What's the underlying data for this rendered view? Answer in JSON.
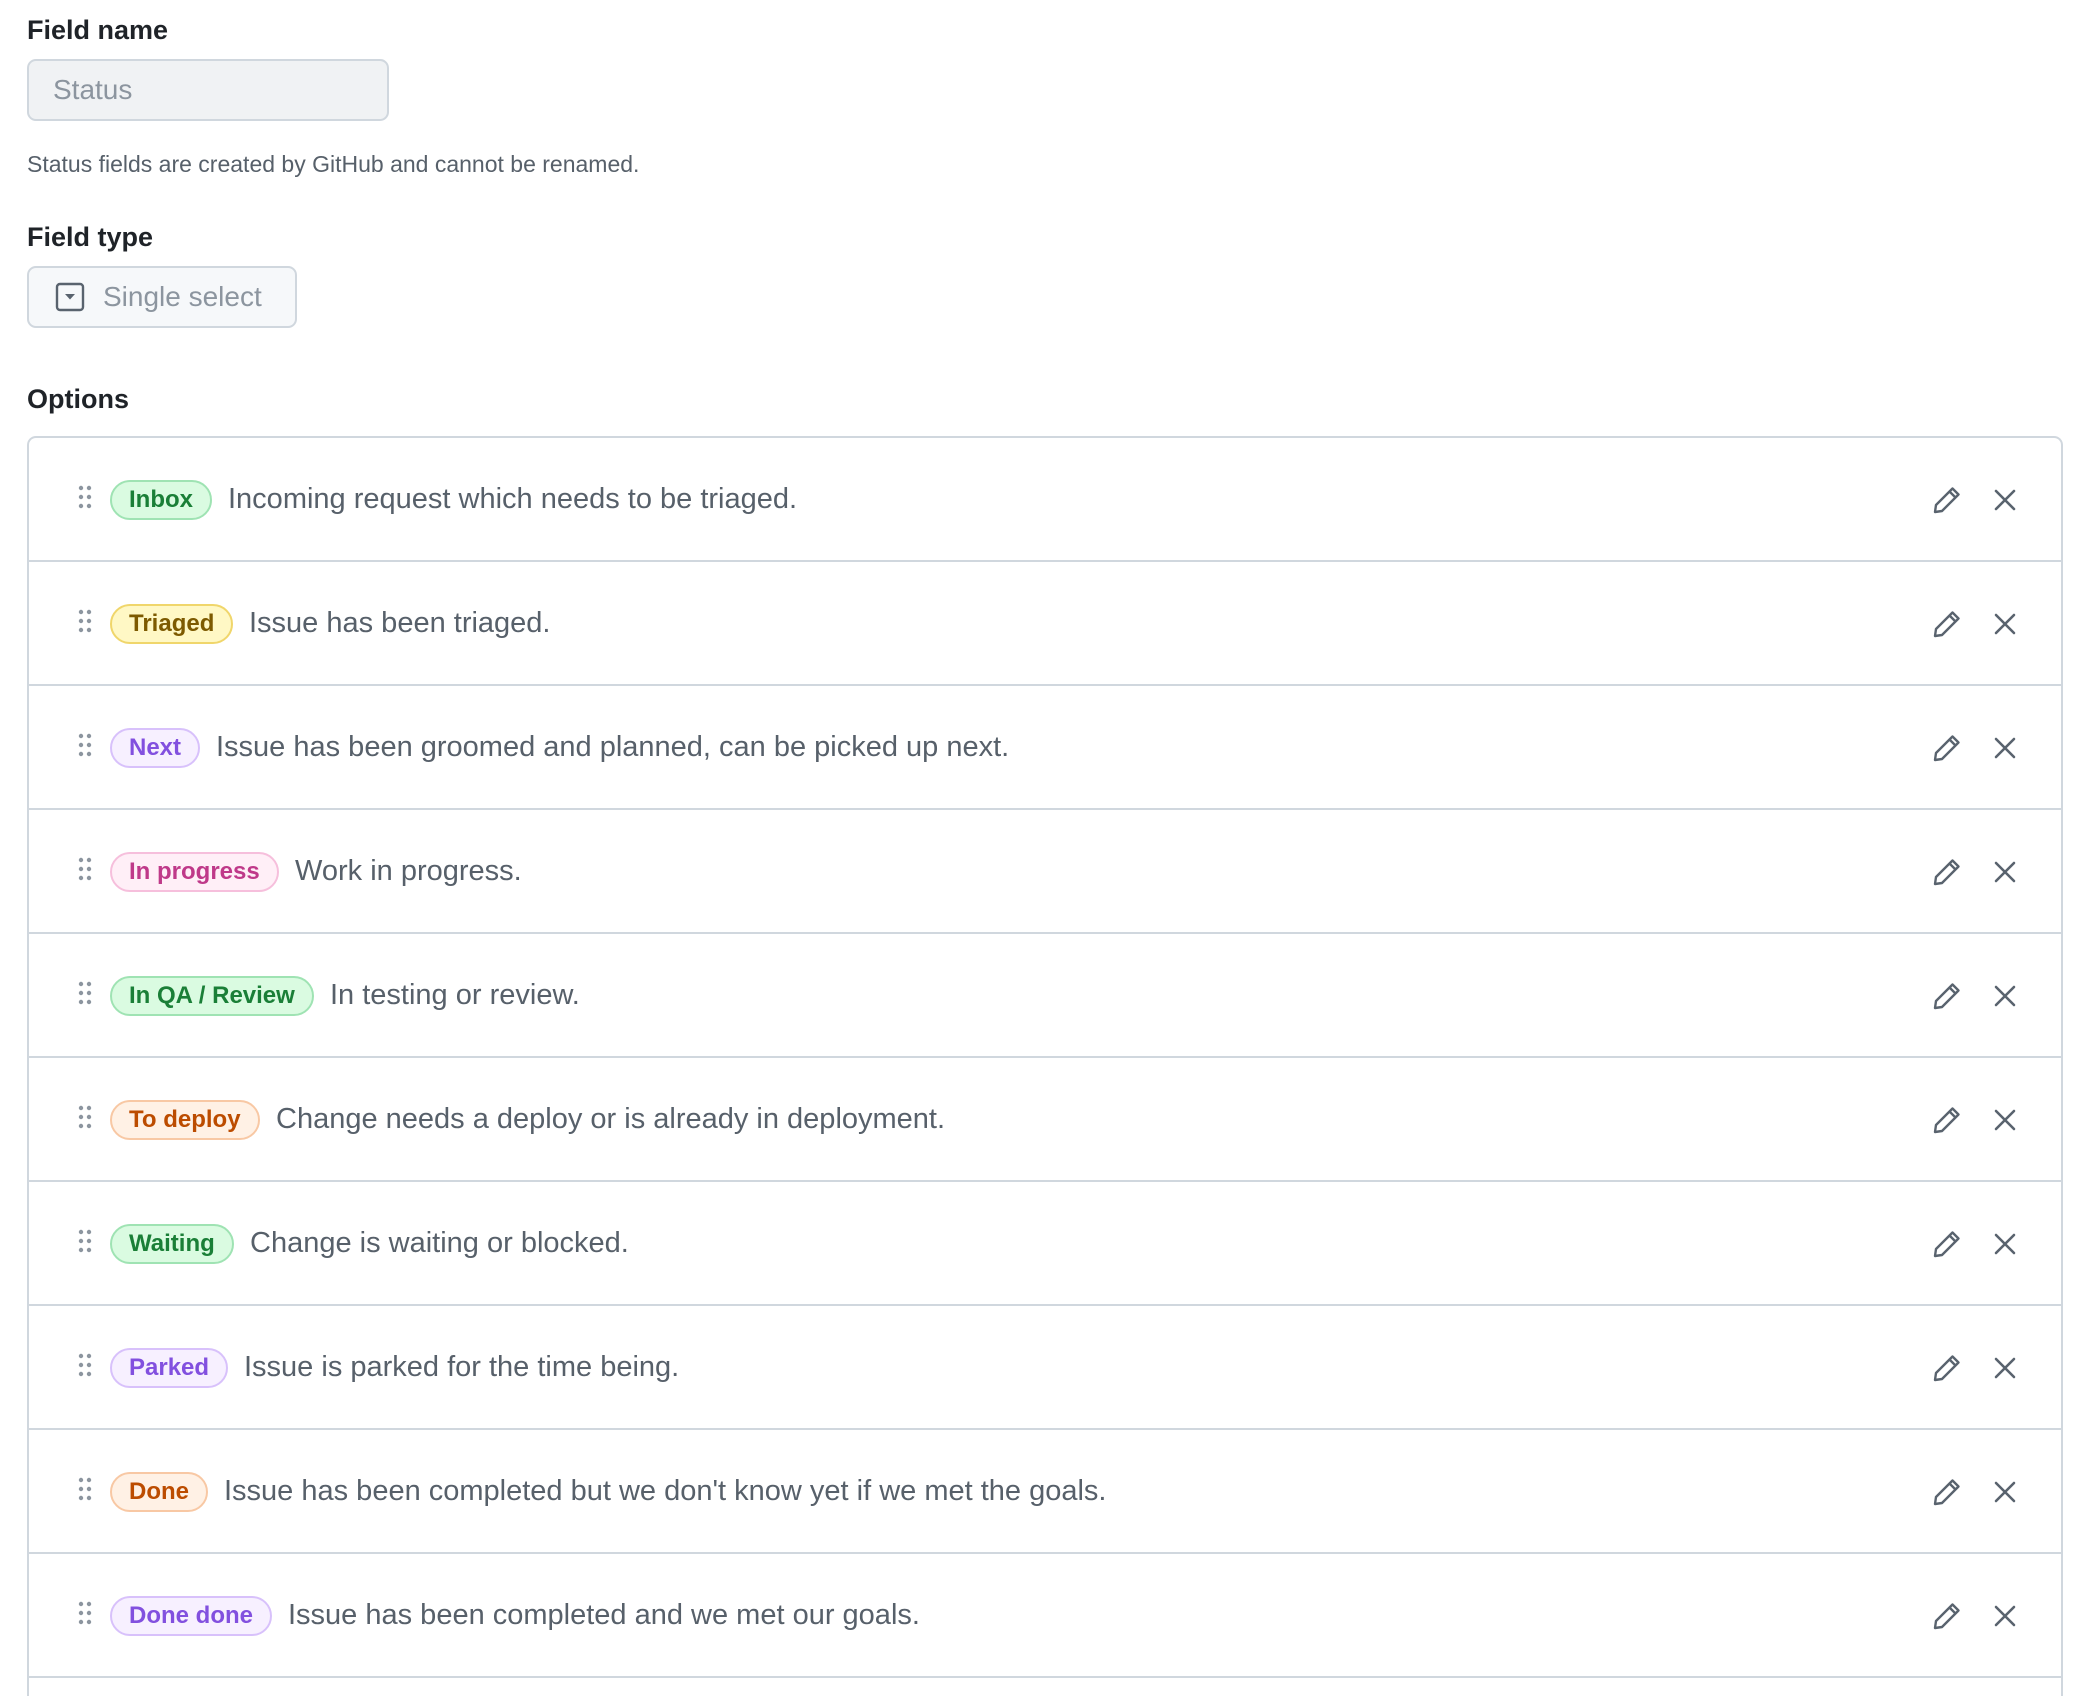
{
  "field_name": {
    "label": "Field name",
    "value": "Status",
    "hint": "Status fields are created by GitHub and cannot be renamed."
  },
  "field_type": {
    "label": "Field type",
    "value": "Single select",
    "icon": "select-icon"
  },
  "options": {
    "label": "Options",
    "items": [
      {
        "name": "Inbox",
        "description": "Incoming request which needs to be triaged.",
        "color": "green"
      },
      {
        "name": "Triaged",
        "description": "Issue has been triaged.",
        "color": "yellow"
      },
      {
        "name": "Next",
        "description": "Issue has been groomed and planned, can be picked up next.",
        "color": "purple"
      },
      {
        "name": "In progress",
        "description": "Work in progress.",
        "color": "pink"
      },
      {
        "name": "In QA / Review",
        "description": "In testing or review.",
        "color": "green"
      },
      {
        "name": "To deploy",
        "description": "Change needs a deploy or is already in deployment.",
        "color": "orange"
      },
      {
        "name": "Waiting",
        "description": "Change is waiting or blocked.",
        "color": "green"
      },
      {
        "name": "Parked",
        "description": "Issue is parked for the time being.",
        "color": "purple"
      },
      {
        "name": "Done",
        "description": "Issue has been completed but we don't know yet if we met the goals.",
        "color": "orange"
      },
      {
        "name": "Done done",
        "description": "Issue has been completed and we met our goals.",
        "color": "purple"
      }
    ]
  },
  "palette": {
    "green": {
      "bg": "#dafbe1",
      "border": "#9fe3b3",
      "text": "#1a7f37"
    },
    "yellow": {
      "bg": "#fff8c5",
      "border": "#f0d66b",
      "text": "#7d5a00"
    },
    "purple": {
      "bg": "#f7f0ff",
      "border": "#d8c1fb",
      "text": "#8250df"
    },
    "pink": {
      "bg": "#ffeff7",
      "border": "#f6bfdc",
      "text": "#bf3989"
    },
    "orange": {
      "bg": "#fff1e5",
      "border": "#f8c8a4",
      "text": "#bc4c00"
    }
  },
  "icons": {
    "drag": "grabber-icon",
    "edit": "pencil-icon",
    "remove": "close-icon"
  }
}
